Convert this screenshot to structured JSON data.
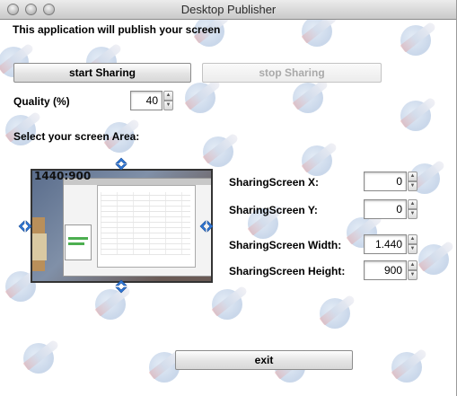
{
  "window": {
    "title": "Desktop Publisher"
  },
  "intro": "This application will publish your screen",
  "buttons": {
    "start": "start Sharing",
    "stop": "stop Sharing",
    "exit": "exit"
  },
  "quality": {
    "label": "Quality (%)",
    "value": "40"
  },
  "area_label": "Select your screen Area:",
  "preview": {
    "resolution": "1440:900"
  },
  "fields": {
    "x": {
      "label": "SharingScreen X:",
      "value": "0"
    },
    "y": {
      "label": "SharingScreen Y:",
      "value": "0"
    },
    "width": {
      "label": "SharingScreen Width:",
      "value": "1.440"
    },
    "height": {
      "label": "SharingScreen Height:",
      "value": "900"
    }
  },
  "colors": {
    "arrow_blue": "#2f78d8",
    "window_bg": "#ffffff",
    "watermark": "#c9d7ea"
  },
  "icons": [
    "close-button-icon",
    "minimize-button-icon",
    "zoom-button-icon",
    "arrow-up-icon",
    "arrow-down-icon",
    "arrow-left-icon",
    "arrow-right-icon",
    "rocket-logo-icon"
  ]
}
